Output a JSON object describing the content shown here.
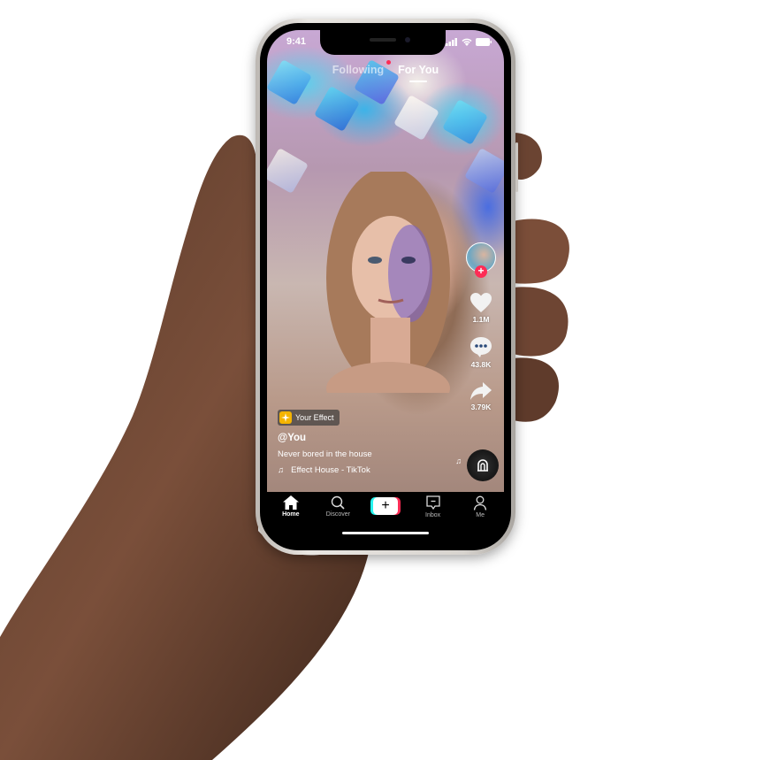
{
  "status_bar": {
    "time": "9:41"
  },
  "top_tabs": {
    "following_label": "Following",
    "for_you_label": "For You",
    "active": "For You",
    "notification_dot_color": "#fe2c55"
  },
  "rail": {
    "avatar_icon": "profile-avatar",
    "follow_icon": "plus-icon",
    "like_count": "1.1M",
    "comment_count": "43.8K",
    "share_count": "3.79K",
    "sound_disc_icon": "effect-house-icon"
  },
  "caption": {
    "effect_label": "Your Effect",
    "username": "@You",
    "description": "Never bored in the house",
    "sound": "Effect House - TikTok"
  },
  "nav": {
    "items": [
      {
        "label": "Home",
        "icon": "home-icon",
        "active": true
      },
      {
        "label": "Discover",
        "icon": "search-icon",
        "active": false
      },
      {
        "label": "",
        "icon": "create-plus-icon",
        "active": false
      },
      {
        "label": "Inbox",
        "icon": "inbox-icon",
        "active": false
      },
      {
        "label": "Me",
        "icon": "profile-icon",
        "active": false
      }
    ]
  },
  "colors": {
    "accent_red": "#fe2c55",
    "accent_cyan": "#25f4ee",
    "effect_chip_yellow": "#f5b400"
  }
}
